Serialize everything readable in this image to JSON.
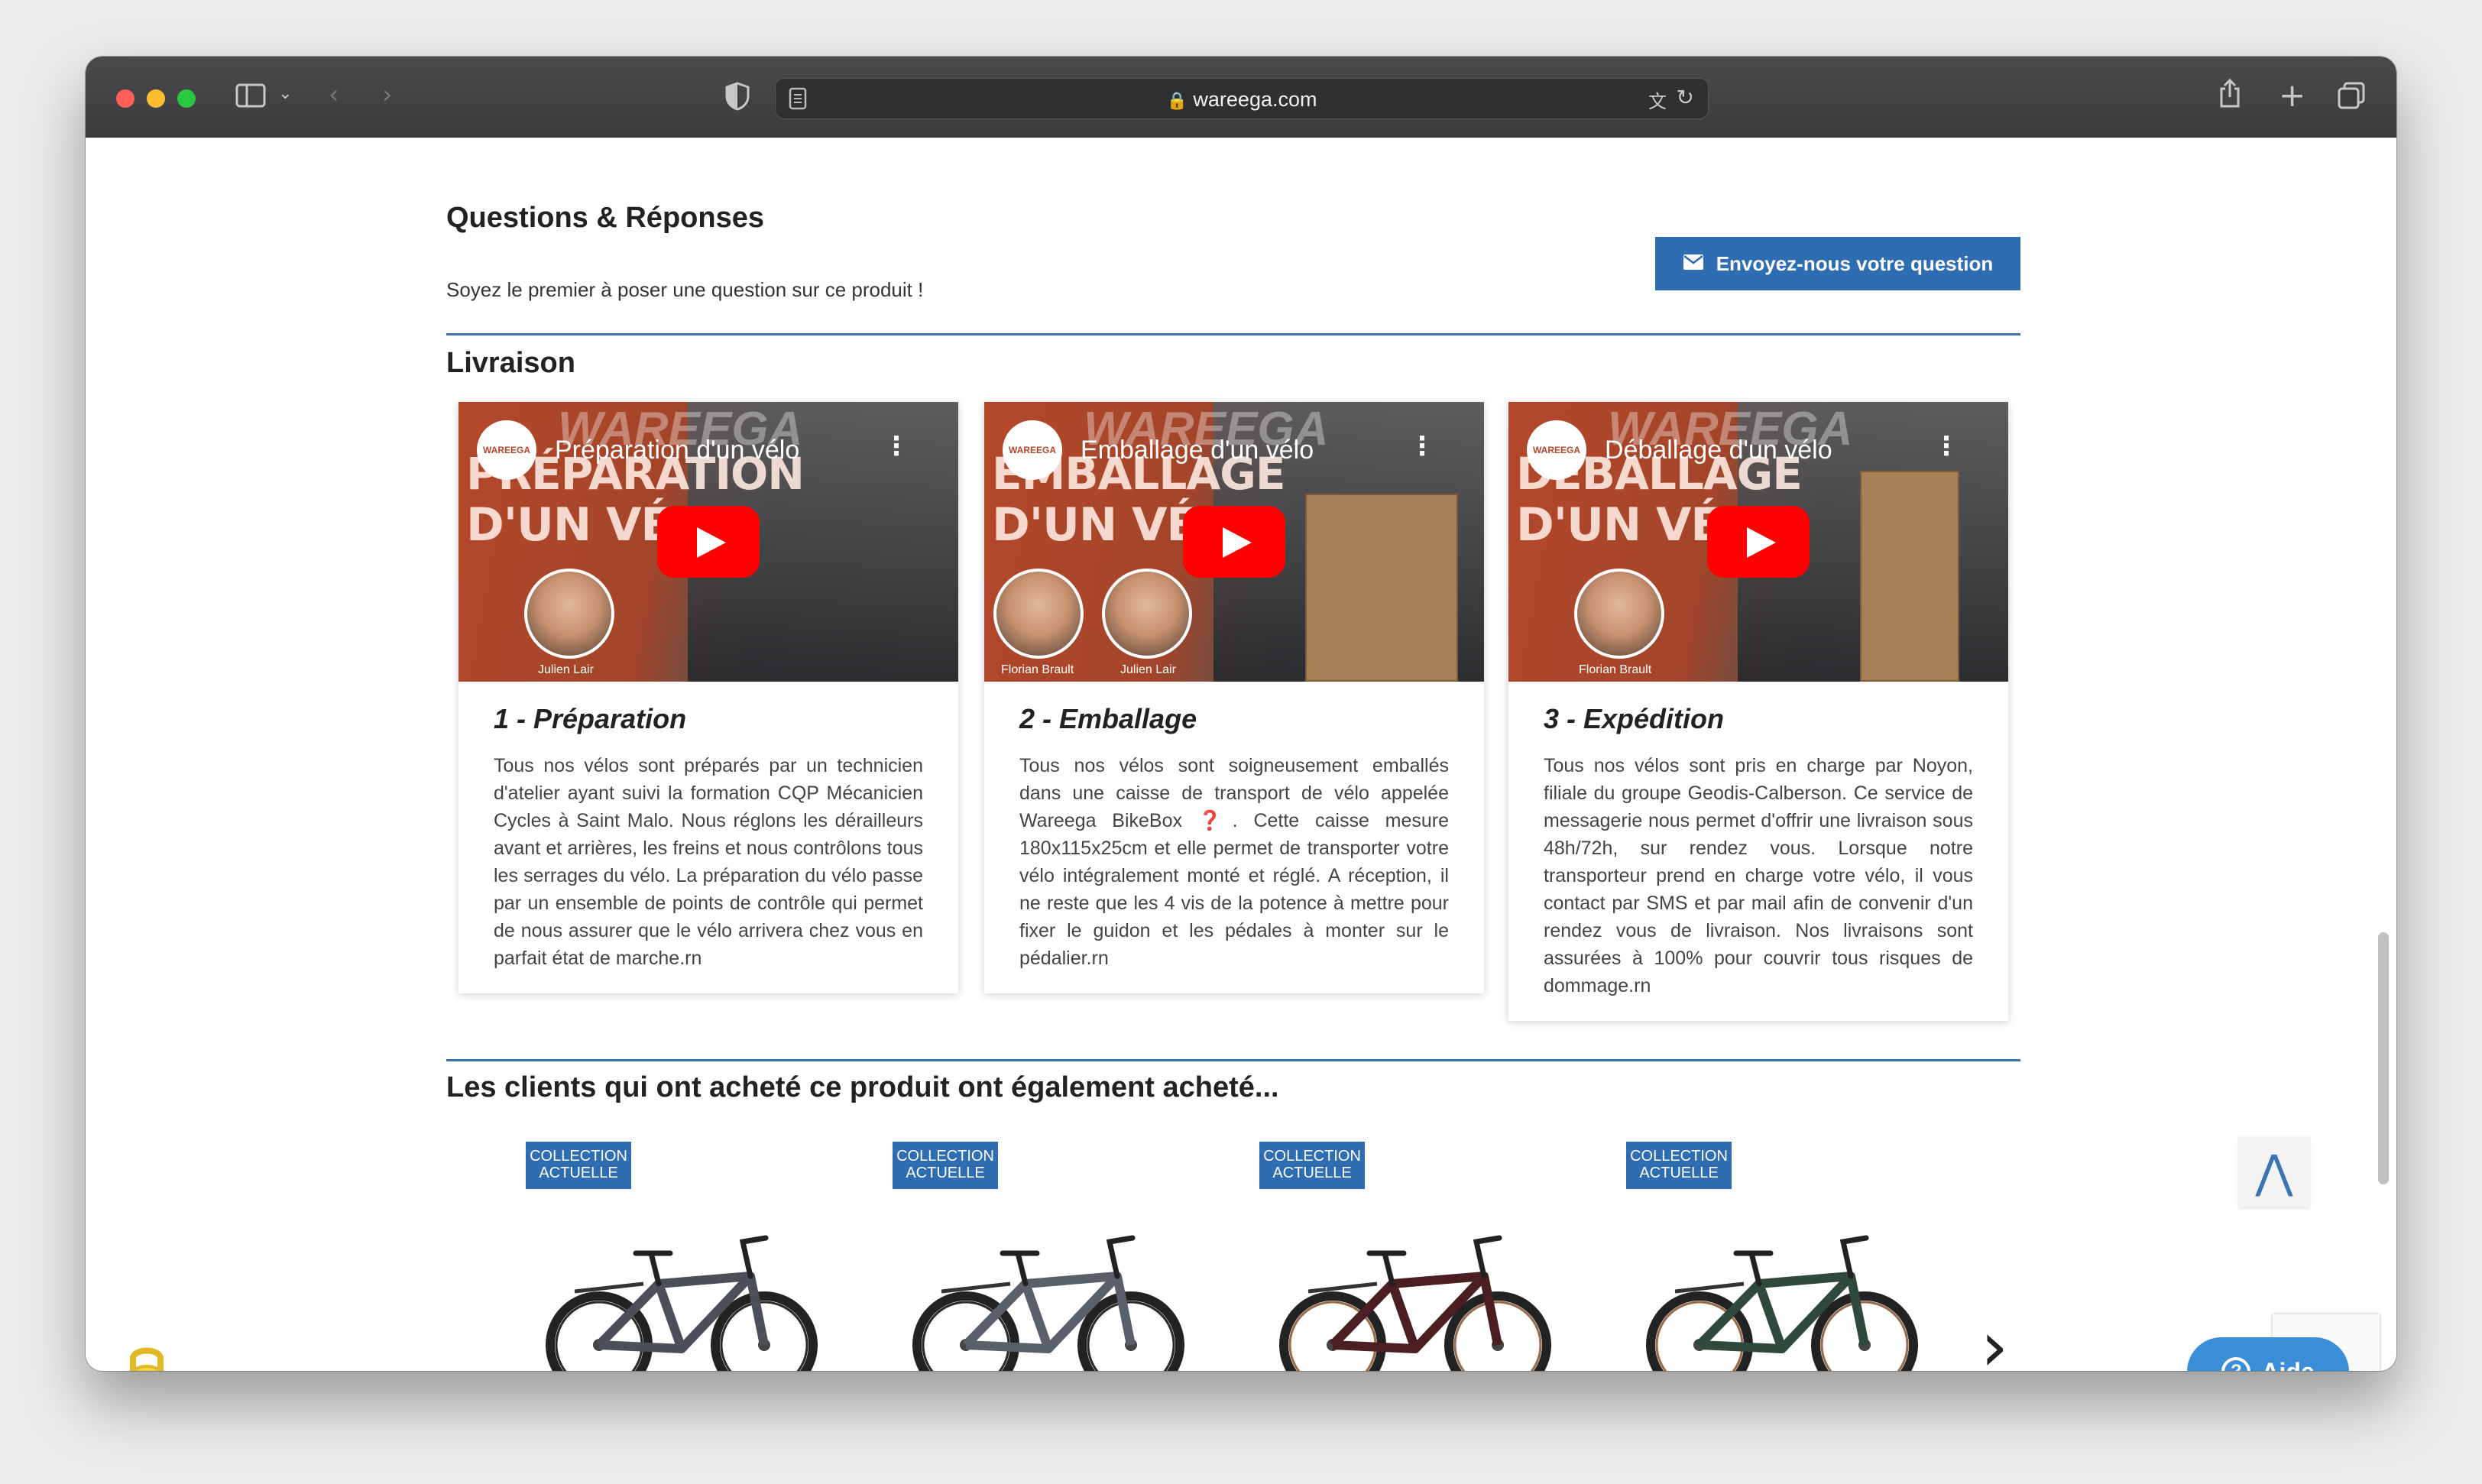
{
  "browser": {
    "url": "wareega.com"
  },
  "qa": {
    "title": "Questions & Réponses",
    "empty_text": "Soyez le premier à poser une question sur ce produit !",
    "ask_button": "Envoyez-nous votre question"
  },
  "livraison": {
    "title": "Livraison",
    "cards": [
      {
        "video_title": "Préparation d'un vélo",
        "thumb_line1": "PRÉPARATION",
        "thumb_line2": "D'UN VÉLO",
        "people": [
          "Julien Lair"
        ],
        "title": "1 - Préparation",
        "text": "Tous nos vélos sont préparés par un technicien d'atelier ayant suivi la formation CQP Mécanicien Cycles à Saint Malo. Nous réglons les dérailleurs avant et arrières, les freins et nous contrôlons tous les serrages du vélo. La préparation du vélo passe par un ensemble de points de contrôle qui permet de nous assurer que le vélo arrivera chez vous en parfait état de marche.rn"
      },
      {
        "video_title": "Emballage d'un vélo",
        "thumb_line1": "EMBALLAGE",
        "thumb_line2": "D'UN VÉLO",
        "people": [
          "Florian Brault",
          "Julien Lair"
        ],
        "title": "2 - Emballage",
        "text": "Tous nos vélos sont soigneusement emballés dans une caisse de transport de vélo appelée Wareega BikeBox ❓. Cette caisse mesure 180x115x25cm et elle permet de transporter votre vélo intégralement monté et réglé. A réception, il ne reste que les 4 vis de la potence à mettre pour fixer le guidon et les pédales à monter sur le pédalier.rn"
      },
      {
        "video_title": "Déballage d'un vélo",
        "thumb_line1": "DÉBALLAGE",
        "thumb_line2": "D'UN VÉLO",
        "people": [
          "Florian Brault"
        ],
        "title": "3 - Expédition",
        "text": "Tous nos vélos sont pris en charge par Noyon, filiale du groupe Geodis-Calberson. Ce service de messagerie nous permet d'offrir une livraison sous 48h/72h, sur rendez vous. Lorsque notre transporteur prend en charge votre vélo, il vous contact par SMS et par mail afin de convenir d'un rendez vous de livraison. Nos livraisons sont assurées à 100% pour couvrir tous risques de dommage.rn"
      }
    ],
    "logo_text": "WAREEGA",
    "ghost_text": "WAREEGA"
  },
  "related": {
    "title": "Les clients qui ont acheté ce produit ont également acheté...",
    "badge_line1": "COLLECTION",
    "badge_line2": "ACTUELLE",
    "products": [
      {
        "frame_color": "#4a4f58",
        "rim": "#2a2a2a"
      },
      {
        "frame_color": "#5a606a",
        "rim": "#2a2a2a"
      },
      {
        "frame_color": "#4a1e22",
        "rim": "#9a6a4a"
      },
      {
        "frame_color": "#2f4a3c",
        "rim": "#9a6a4a"
      }
    ]
  },
  "widgets": {
    "aide_label": "Aide",
    "scroll_top": "^"
  }
}
